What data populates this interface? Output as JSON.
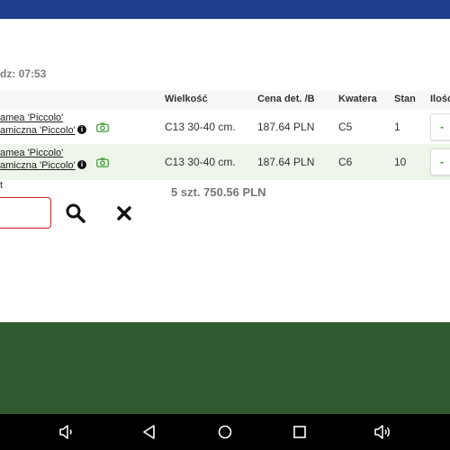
{
  "header": {
    "time_label": "dz: 07:53"
  },
  "table": {
    "columns": [
      "Wielkość",
      "Cena det. /B",
      "Kwatera",
      "Stan",
      "Ilość"
    ],
    "rows": [
      {
        "name_line1": "amea 'Piccolo'",
        "name_line2": "amiczna 'Piccolo'",
        "size": "C13 30-40 cm.",
        "price": "187.64 PLN",
        "quarter": "C5",
        "stock": "1",
        "qty_action": "-"
      },
      {
        "name_line1": "amea 'Piccolo'",
        "name_line2": "amiczna 'Piccolo'",
        "size": "C13 30-40 cm.",
        "price": "187.64 PLN",
        "quarter": "C6",
        "stock": "10",
        "qty_action": "-"
      }
    ]
  },
  "footer_fragment": "t",
  "summary": "5 szt. 750.56 PLN",
  "search": {
    "value": ""
  },
  "icons": {
    "info": "info-icon",
    "camera": "camera-icon",
    "search": "search-icon",
    "clear": "close-icon",
    "nav": [
      "volume-down-icon",
      "back-icon",
      "home-icon",
      "recents-icon",
      "volume-up-icon"
    ]
  },
  "colors": {
    "topbar": "#1e3f8f",
    "row_highlight": "#edf6e8",
    "accent_green": "#4aa040",
    "input_border": "#d0202a",
    "background_band": "#2f5a2f",
    "navbar": "#000000"
  }
}
